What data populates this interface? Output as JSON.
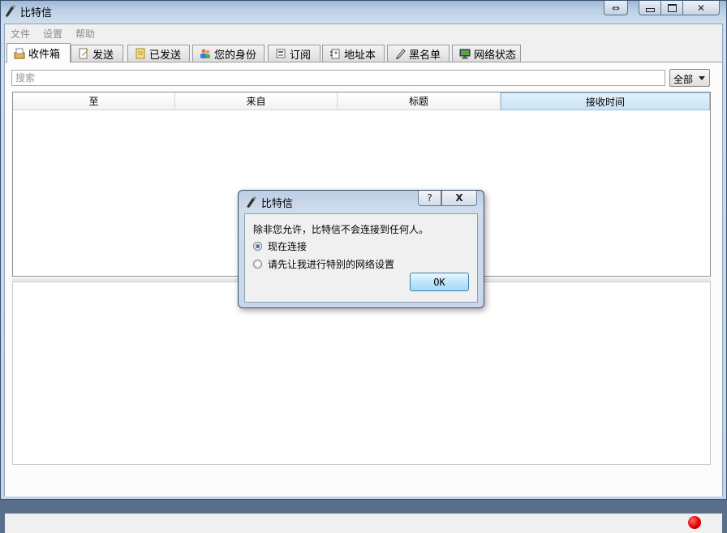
{
  "window": {
    "title": "比特信",
    "buttons": {
      "restore_glyph": "⇔",
      "minimize_glyph": "▭",
      "maximize_glyph": "◻",
      "close_glyph": "✕"
    }
  },
  "menu": [
    "文件",
    "设置",
    "帮助"
  ],
  "tabs": [
    {
      "label": "收件箱",
      "icon": "inbox-icon",
      "active": true
    },
    {
      "label": "发送",
      "icon": "send-icon"
    },
    {
      "label": "已发送",
      "icon": "sent-icon"
    },
    {
      "label": "您的身份",
      "icon": "identities-icon"
    },
    {
      "label": "订阅",
      "icon": "subscriptions-icon"
    },
    {
      "label": "地址本",
      "icon": "address-book-icon"
    },
    {
      "label": "黑名单",
      "icon": "blacklist-icon"
    },
    {
      "label": "网络状态",
      "icon": "network-status-icon"
    }
  ],
  "inbox": {
    "search_placeholder": "搜索",
    "filter_value": "全部",
    "columns": [
      "至",
      "来自",
      "标题",
      "接收时间"
    ],
    "sorted_column": "接收时间",
    "rows": []
  },
  "status": {
    "indicator_color": "#e00000"
  },
  "dialog": {
    "title": "比特信",
    "help_glyph": "?",
    "close_glyph": "X",
    "message": "除非您允许，比特信不会连接到任何人。",
    "options": [
      {
        "label": "现在连接",
        "checked": true
      },
      {
        "label": "请先让我进行特别的网络设置",
        "checked": false
      }
    ],
    "ok_label": "OK"
  }
}
